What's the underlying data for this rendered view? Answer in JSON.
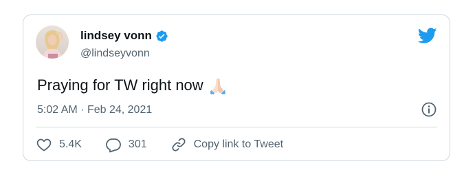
{
  "author": {
    "display_name": "lindsey vonn",
    "handle": "@lindseyvonn",
    "verified": true
  },
  "tweet": {
    "text": "Praying for TW right now",
    "emoji": "folded-hands-emoji"
  },
  "meta": {
    "time": "5:02 AM",
    "separator": "·",
    "date": "Feb 24, 2021"
  },
  "actions": {
    "like_count": "5.4K",
    "reply_count": "301",
    "copy_link_label": "Copy link to Tweet"
  },
  "icons": {
    "brand": "twitter-bird-icon",
    "verified": "verified-badge-icon",
    "info": "info-icon",
    "like": "heart-icon",
    "reply": "reply-bubble-icon",
    "link": "link-icon"
  },
  "colors": {
    "brand_blue": "#1d9bf0",
    "text_primary": "#0f1419",
    "text_secondary": "#536471",
    "border": "#cfd9de"
  }
}
